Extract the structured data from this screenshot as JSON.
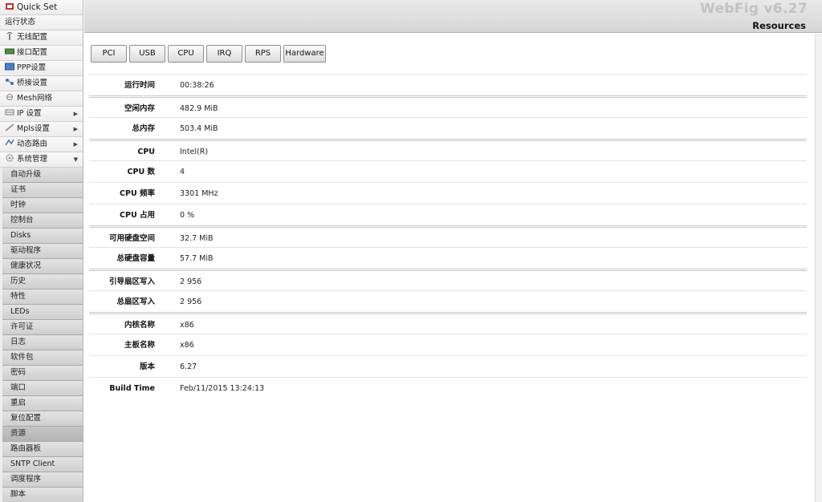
{
  "sidebar": {
    "top_items": [
      {
        "label": "Quick Set",
        "icon": "quick-set-icon",
        "arrow": ""
      },
      {
        "label": "运行状态",
        "icon": "",
        "arrow": ""
      },
      {
        "label": "无线配置",
        "icon": "wireless-icon",
        "arrow": ""
      },
      {
        "label": "接口配置",
        "icon": "interface-icon",
        "arrow": ""
      },
      {
        "label": "PPP设置",
        "icon": "ppp-icon",
        "arrow": ""
      },
      {
        "label": "桥接设置",
        "icon": "bridge-icon",
        "arrow": ""
      },
      {
        "label": "Mesh网络",
        "icon": "mesh-icon",
        "arrow": ""
      },
      {
        "label": "IP 设置",
        "icon": "ip-icon",
        "arrow": "▶"
      },
      {
        "label": "Mpls设置",
        "icon": "mpls-icon",
        "arrow": "▶"
      },
      {
        "label": "动态路由",
        "icon": "routing-icon",
        "arrow": "▶"
      },
      {
        "label": "系统管理",
        "icon": "system-gear-icon",
        "arrow": "▼"
      }
    ],
    "sub_items": [
      "自动升级",
      "证书",
      "时钟",
      "控制台",
      "Disks",
      "驱动程序",
      "健康状况",
      "历史",
      "特性",
      "LEDs",
      "许可证",
      "日志",
      "软件包",
      "密码",
      "端口",
      "重启",
      "复位配置",
      "资源",
      "路由器板",
      "SNTP Client",
      "调度程序",
      "脚本"
    ],
    "active_sub": "资源"
  },
  "header": {
    "brand": "WebFig v6.27",
    "title": "Resources"
  },
  "tabs": [
    "PCI",
    "USB",
    "CPU",
    "IRQ",
    "RPS",
    "Hardware"
  ],
  "resources": [
    {
      "label": "运行时间",
      "value": "00:38:26"
    },
    {
      "label": "空闲内存",
      "value": "482.9 MiB"
    },
    {
      "label": "总内存",
      "value": "503.4 MiB"
    },
    {
      "label": "CPU",
      "value": "Intel(R)"
    },
    {
      "label": "CPU 数",
      "value": "4"
    },
    {
      "label": "CPU 频率",
      "value": "3301 MHz"
    },
    {
      "label": "CPU 占用",
      "value": "0 %"
    },
    {
      "label": "可用硬盘空间",
      "value": "32.7 MiB"
    },
    {
      "label": "总硬盘容量",
      "value": "57.7 MiB"
    },
    {
      "label": "引导扇区写入",
      "value": "2 956"
    },
    {
      "label": "总扇区写入",
      "value": "2 956"
    },
    {
      "label": "内核名称",
      "value": "x86"
    },
    {
      "label": "主板名称",
      "value": "x86"
    },
    {
      "label": "版本",
      "value": "6.27"
    },
    {
      "label": "Build Time",
      "value": "Feb/11/2015 13:24:13"
    }
  ],
  "colors": {
    "active_sub": "#b9b9b9",
    "brand": "#c2c2c2"
  }
}
